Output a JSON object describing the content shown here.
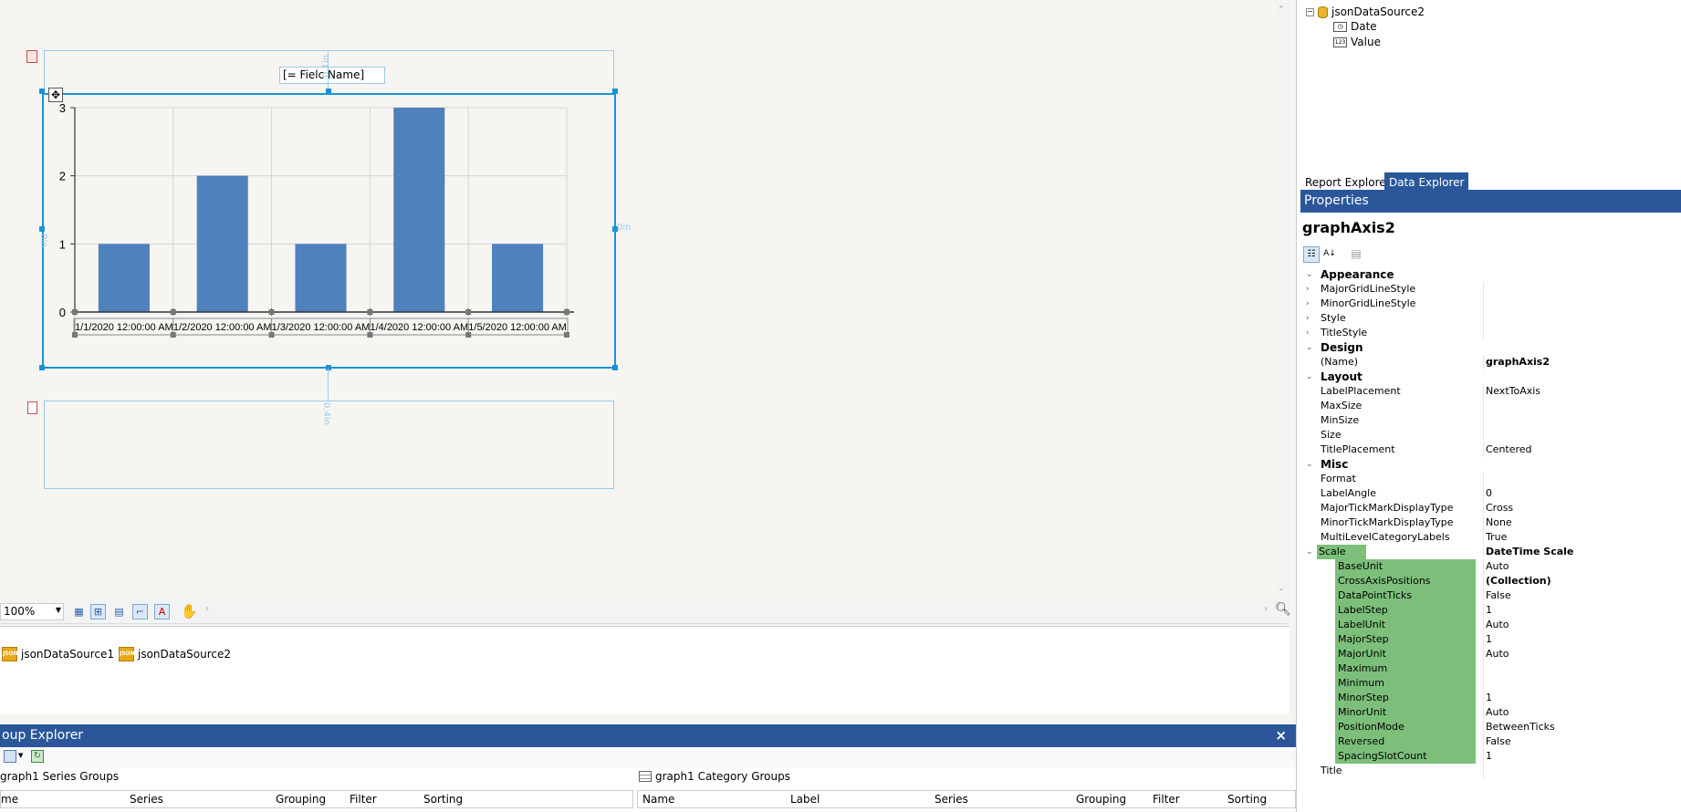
{
  "designer": {
    "textbox_label": "[= Fielc Name]",
    "guide_top": "0.1in",
    "guide_left": "0in",
    "guide_right": "0in",
    "guide_bottom": "0.4in"
  },
  "chart_data": {
    "type": "bar",
    "categories": [
      "1/1/2020 12:00:00 AM",
      "1/2/2020 12:00:00 AM",
      "1/3/2020 12:00:00 AM",
      "1/4/2020 12:00:00 AM",
      "1/5/2020 12:00:00 AM"
    ],
    "values": [
      1,
      2,
      1,
      3,
      1
    ],
    "yticks": [
      "0",
      "1",
      "2",
      "3"
    ],
    "ylim": [
      0,
      3
    ],
    "bar_color": "#4f81bd",
    "grid": true
  },
  "zoombar": {
    "zoom": "100%"
  },
  "tray": {
    "sources": [
      "jsonDataSource1",
      "jsonDataSource2"
    ]
  },
  "group_explorer": {
    "title": "oup Explorer",
    "close": "×",
    "series_title": "graph1 Series Groups",
    "category_title": "graph1 Category Groups",
    "series_cols": [
      "me",
      "Series",
      "Grouping",
      "Filter",
      "Sorting"
    ],
    "category_cols": [
      "Name",
      "Label",
      "Series",
      "Grouping",
      "Filter",
      "Sorting"
    ]
  },
  "data_explorer": {
    "tree": {
      "root": "jsonDataSource2",
      "fields": [
        "Date",
        "Value"
      ]
    },
    "tabs": [
      "Report Explorer",
      "Data Explorer"
    ]
  },
  "properties": {
    "header": "Properties",
    "object_name": "graphAxis2",
    "rows": [
      {
        "name": "Appearance",
        "value": "",
        "type": "category"
      },
      {
        "name": "MajorGridLineStyle",
        "value": "",
        "type": "expand"
      },
      {
        "name": "MinorGridLineStyle",
        "value": "",
        "type": "expand"
      },
      {
        "name": "Style",
        "value": "",
        "type": "expand"
      },
      {
        "name": "TitleStyle",
        "value": "",
        "type": "expand"
      },
      {
        "name": "Design",
        "value": "",
        "type": "category"
      },
      {
        "name": "(Name)",
        "value": "graphAxis2",
        "type": "bold"
      },
      {
        "name": "Layout",
        "value": "",
        "type": "category"
      },
      {
        "name": "LabelPlacement",
        "value": "NextToAxis",
        "type": "prop"
      },
      {
        "name": "MaxSize",
        "value": "",
        "type": "prop"
      },
      {
        "name": "MinSize",
        "value": "",
        "type": "prop"
      },
      {
        "name": "Size",
        "value": "",
        "type": "prop"
      },
      {
        "name": "TitlePlacement",
        "value": "Centered",
        "type": "prop"
      },
      {
        "name": "Misc",
        "value": "",
        "type": "category"
      },
      {
        "name": "Format",
        "value": "",
        "type": "prop"
      },
      {
        "name": "LabelAngle",
        "value": "0",
        "type": "prop"
      },
      {
        "name": "MajorTickMarkDisplayType",
        "value": "Cross",
        "type": "prop"
      },
      {
        "name": "MinorTickMarkDisplayType",
        "value": "None",
        "type": "prop"
      },
      {
        "name": "MultiLevelCategoryLabels",
        "value": "True",
        "type": "prop"
      },
      {
        "name": "Scale",
        "value": "DateTime Scale",
        "type": "scale"
      },
      {
        "name": "BaseUnit",
        "value": "Auto",
        "type": "sub"
      },
      {
        "name": "CrossAxisPositions",
        "value": "(Collection)",
        "type": "subbold"
      },
      {
        "name": "DataPointTicks",
        "value": "False",
        "type": "sub"
      },
      {
        "name": "LabelStep",
        "value": "1",
        "type": "sub"
      },
      {
        "name": "LabelUnit",
        "value": "Auto",
        "type": "sub"
      },
      {
        "name": "MajorStep",
        "value": "1",
        "type": "sub"
      },
      {
        "name": "MajorUnit",
        "value": "Auto",
        "type": "sub"
      },
      {
        "name": "Maximum",
        "value": "",
        "type": "sub"
      },
      {
        "name": "Minimum",
        "value": "",
        "type": "sub"
      },
      {
        "name": "MinorStep",
        "value": "1",
        "type": "sub"
      },
      {
        "name": "MinorUnit",
        "value": "Auto",
        "type": "sub"
      },
      {
        "name": "PositionMode",
        "value": "BetweenTicks",
        "type": "sub"
      },
      {
        "name": "Reversed",
        "value": "False",
        "type": "sub"
      },
      {
        "name": "SpacingSlotCount",
        "value": "1",
        "type": "sub"
      },
      {
        "name": "Title",
        "value": "",
        "type": "prop"
      }
    ]
  }
}
